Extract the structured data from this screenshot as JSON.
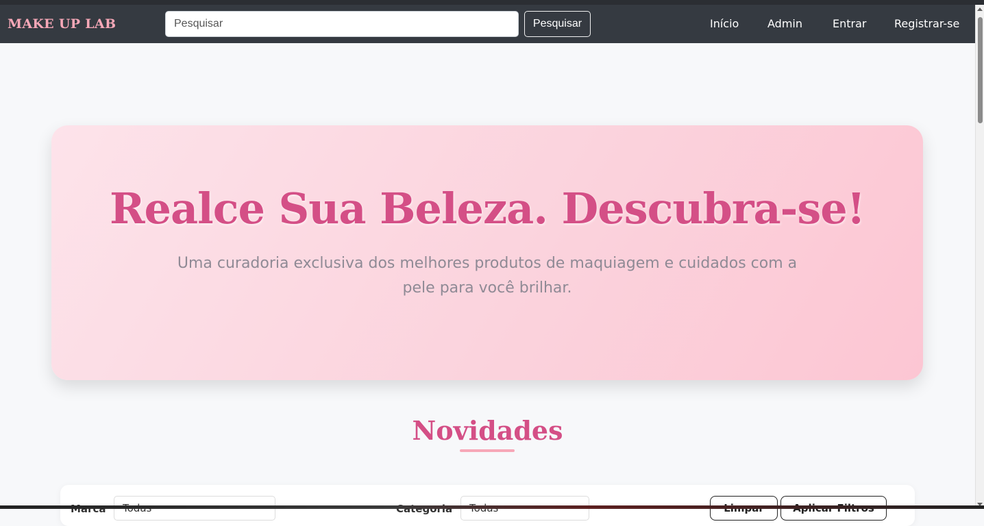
{
  "navbar": {
    "brand": "MAKE UP LAB",
    "search_placeholder": "Pesquisar",
    "search_button": "Pesquisar",
    "links": [
      "Início",
      "Admin",
      "Entrar",
      "Registrar-se"
    ]
  },
  "hero": {
    "title": "Realce Sua Beleza. Descubra-se!",
    "subtitle": "Uma curadoria exclusiva dos melhores produtos de maquiagem e cuidados com a pele para você brilhar."
  },
  "section": {
    "title": "Novidades"
  },
  "filters": {
    "brand_label": "Marca",
    "brand_value": "Todas",
    "category_label": "Categoria",
    "category_value": "Todas",
    "clear_button": "Limpar",
    "apply_button": "Aplicar Filtros"
  },
  "colors": {
    "navbar_bg": "#353a41",
    "brand": "#f7a8b8",
    "accent": "#d44f86"
  }
}
